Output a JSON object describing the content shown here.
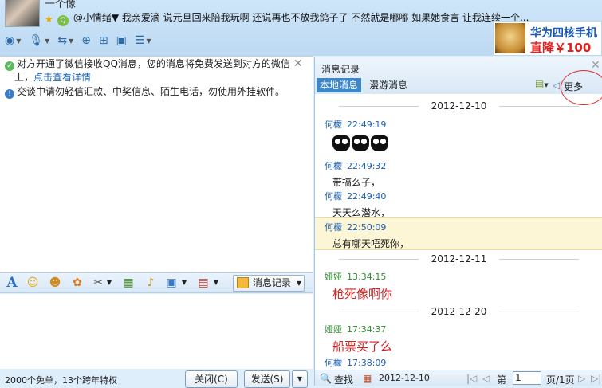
{
  "contact": {
    "name": "一个像",
    "signature": "@小情绪▼ 我亲爱滴 说元旦回来陪我玩啊   还说再也不放我鸽子了  不然就是嘟嘟  如果她食言  让我连续一个..."
  },
  "ad": {
    "line1": "华为四核手机",
    "line2": "直降￥100"
  },
  "notices": {
    "wechat_text": "对方开通了微信接收QQ消息，您的消息将免费发送到对方的微信",
    "wechat_text2": "上，",
    "wechat_link": "点击查看详情",
    "security_text": "交谈中请勿轻信汇款、中奖信息、陌生电话，勿使用外挂软件。"
  },
  "input_toolbar": {
    "history_label": "消息记录"
  },
  "footer": {
    "status_text": "2000个免单，13个跨年特权",
    "close_label": "关闭(C)",
    "send_label": "发送(S)"
  },
  "history": {
    "title": "消息记录",
    "tabs": [
      {
        "label": "本地消息"
      },
      {
        "label": "漫游消息"
      }
    ],
    "more_label": "更多",
    "dates": [
      "2012-12-10",
      "2012-12-11",
      "2012-12-20"
    ],
    "messages": [
      {
        "sender": "何檬",
        "time": "22:49:19",
        "text": ""
      },
      {
        "sender": "何檬",
        "time": "22:49:32",
        "text": "带搞么子，"
      },
      {
        "sender": "何檬",
        "time": "22:49:40",
        "text": "天天么潜水，"
      },
      {
        "sender": "何檬",
        "time": "22:50:09",
        "text": "总有哪天唔死你，"
      },
      {
        "sender": "娅娅",
        "time": "13:34:15",
        "text": "枪死像啊你"
      },
      {
        "sender": "娅娅",
        "time": "17:34:37",
        "text": "船票买了么"
      },
      {
        "sender": "何檬",
        "time": "17:38:09",
        "text": ""
      }
    ],
    "bottom": {
      "search_label": "查找",
      "date_value": "2012-12-10",
      "page_prefix": "第",
      "page_value": "1",
      "page_suffix": "页/1页"
    }
  },
  "colors": {
    "accent": "#3d86c8",
    "link": "#1a62b5",
    "red_msg": "#d11f1f",
    "green_sender": "#2e8b2e"
  }
}
